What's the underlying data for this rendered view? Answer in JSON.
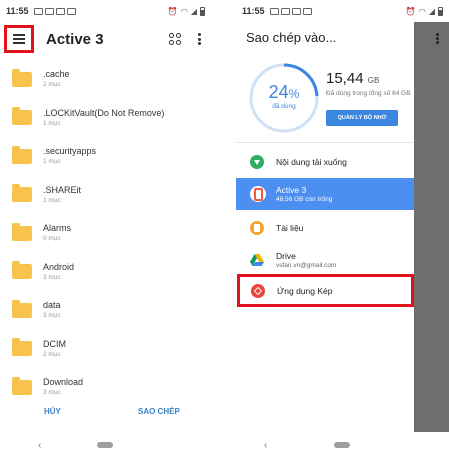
{
  "left": {
    "status_time": "11:55",
    "title": "Active 3",
    "folders": [
      {
        "name": ".cache",
        "count": "2 mục"
      },
      {
        "name": ".LOCKitVault(Do Not Remove)",
        "count": "1 mục"
      },
      {
        "name": ".securityapps",
        "count": "1 mục"
      },
      {
        "name": ".SHAREit",
        "count": "1 mục"
      },
      {
        "name": "Alarms",
        "count": "0 mục"
      },
      {
        "name": "Android",
        "count": "3 mục"
      },
      {
        "name": "data",
        "count": "3 mục"
      },
      {
        "name": "DCIM",
        "count": "2 mục"
      },
      {
        "name": "Download",
        "count": "3 mục"
      }
    ],
    "cancel_label": "HỦY",
    "copy_label": "SAO CHÉP",
    "nav_back": "‹"
  },
  "right": {
    "status_time": "11:55",
    "title": "Sao chép vào...",
    "storage": {
      "percent": "24",
      "percent_sign": "%",
      "used_fraction": 0.24,
      "used_label": "đã dùng",
      "size": "15,44",
      "unit": "GB",
      "description": "Đã dùng trong tổng số 64 GB",
      "manage_button": "QUẢN LÝ BỘ NHỚ"
    },
    "locations": [
      {
        "name": "Nội dung tải xuống",
        "sub": "",
        "icon": "download-icon"
      },
      {
        "name": "Active 3",
        "sub": "48,56 GB còn trống",
        "icon": "phone-storage-icon"
      },
      {
        "name": "Tài liệu",
        "sub": "",
        "icon": "document-icon"
      },
      {
        "name": "Drive",
        "sub": "vsfan.vn@gmail.com",
        "icon": "drive-icon"
      },
      {
        "name": "Ứng dụng Kép",
        "sub": "",
        "icon": "dual-app-icon"
      }
    ],
    "nav_back": "‹"
  },
  "colors": {
    "accent_blue": "#3b86e0",
    "selected_row": "#4c8ff0",
    "highlight_red": "#e0121b",
    "folder_yellow": "#f8c34d",
    "scrim": "#6e6e6e"
  }
}
